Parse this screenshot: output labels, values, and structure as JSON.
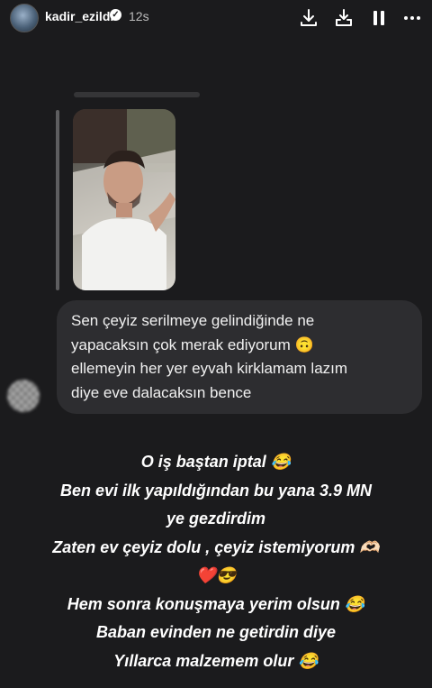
{
  "header": {
    "username": "kadir_ezildi",
    "verified_icon": "verified-badge-icon",
    "time": "12s",
    "controls": [
      "download-icon",
      "save-to-collection-icon",
      "pause-icon",
      "more-icon"
    ]
  },
  "conversation": {
    "quoted_message_text": "",
    "reply_bubble_lines": [
      "Sen çeyiz serilmeye  gelindiğinde ne",
      "yapacaksın çok merak ediyorum 🙃",
      "ellemeyin her yer eyvah kirklamam lazım",
      "diye eve dalacaksın bence"
    ]
  },
  "overlay_text": {
    "lines": [
      "O iş baştan iptal 😂",
      "Ben evi ilk yapıldığından bu yana 3.9 MN",
      "ye gezdirdim",
      "Zaten ev çeyiz dolu , çeyiz istemiyorum 🫶🏻",
      "❤️😎",
      "Hem sonra konuşmaya yerim olsun 😂",
      "Baban evinden ne getirdin diye",
      "Yıllarca malzemem olur 😂"
    ]
  },
  "colors": {
    "background": "#1b1b1d",
    "bubble": "#2d2d30",
    "text": "#ffffff"
  }
}
